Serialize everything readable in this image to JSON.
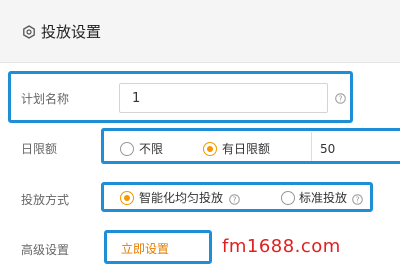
{
  "header": {
    "title": "投放设置",
    "icon": "hexagon-settings-icon"
  },
  "plan_name": {
    "label": "计划名称",
    "value": "1",
    "help_icon": "question-circle-icon"
  },
  "daily_budget": {
    "label": "日限额",
    "options": [
      {
        "label": "不限",
        "selected": false
      },
      {
        "label": "有日限额",
        "selected": true
      }
    ],
    "value": "50"
  },
  "delivery_method": {
    "label": "投放方式",
    "options": [
      {
        "label": "智能化均匀投放",
        "selected": true,
        "help_icon": "question-circle-icon"
      },
      {
        "label": "标准投放",
        "selected": false,
        "help_icon": "question-circle-icon"
      }
    ]
  },
  "advanced": {
    "label": "高级设置",
    "link_label": "立即设置"
  },
  "watermark": "fm1688.com",
  "colors": {
    "highlight": "#1e8fd6",
    "accent": "#f39800",
    "link": "#e67e00",
    "watermark": "#e02020"
  }
}
